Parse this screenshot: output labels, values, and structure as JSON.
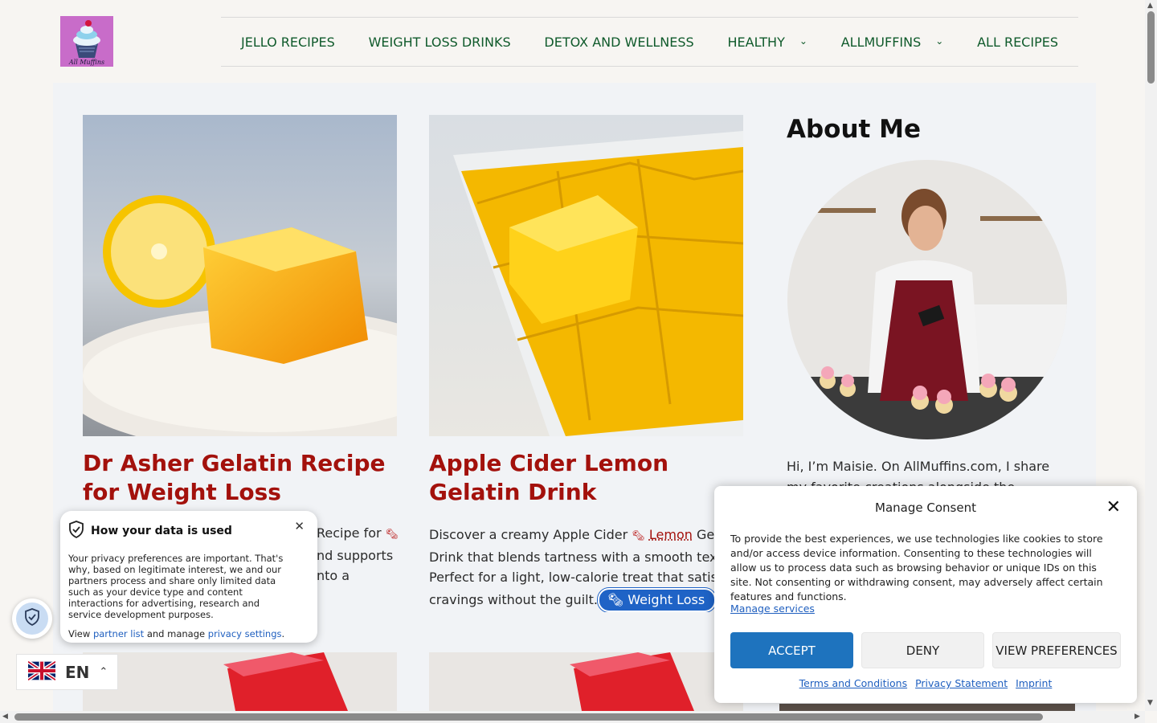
{
  "header": {
    "logo_text": "All Muffins",
    "nav": [
      {
        "label": "JELLO RECIPES",
        "has_dropdown": false
      },
      {
        "label": "WEIGHT LOSS DRINKS",
        "has_dropdown": false
      },
      {
        "label": "DETOX AND WELLNESS",
        "has_dropdown": false
      },
      {
        "label": "HEALTHY",
        "has_dropdown": true
      },
      {
        "label": "ALLMUFFINS",
        "has_dropdown": true
      },
      {
        "label": "ALL RECIPES",
        "has_dropdown": false
      }
    ]
  },
  "cards": [
    {
      "title": "Dr Asher Gelatin Recipe for Weight Loss",
      "excerpt_visible_1": "Recipe for",
      "excerpt_visible_2": "nd supports",
      "excerpt_visible_3": "nto a"
    },
    {
      "title": "Apple Cider Lemon Gelatin Drink",
      "excerpt_line1_a": "Discover a creamy Apple Cider",
      "excerpt_keyword": "Lemon",
      "excerpt_line1_b": "Gela",
      "excerpt_line2": "Drink that blends tartness with a smooth text",
      "excerpt_line3": "Perfect for a light, low-calorie treat that satisf",
      "excerpt_line4": "cravings without the guilt.",
      "tag": "Weight Loss"
    }
  ],
  "about": {
    "title": "About Me",
    "text_line1": "Hi, I’m Maisie. On AllMuffins.com, I share",
    "text_line2": "my favorite creations alongside the"
  },
  "privacy_popup": {
    "title": "How your data is used",
    "body": "Your privacy preferences are important. That's why, based on legitimate interest, we and our partners process and share only limited data such as your device type and content interactions for advertising, research and service development purposes.",
    "foot_prefix": "View",
    "partner_link": "partner list",
    "foot_middle": "and manage",
    "settings_link": "privacy settings",
    "foot_suffix": "."
  },
  "language": {
    "code": "EN"
  },
  "consent": {
    "title": "Manage Consent",
    "text": "To provide the best experiences, we use technologies like cookies to store and/or access device information. Consenting to these technologies will allow us to process data such as browsing behavior or unique IDs on this site. Not consenting or withdrawing consent, may adversely affect certain features and functions.",
    "manage_services": "Manage services",
    "accept": "ACCEPT",
    "deny": "DENY",
    "view_preferences": "VIEW PREFERENCES",
    "links": [
      "Terms and Conditions",
      "Privacy Statement",
      "Imprint"
    ]
  },
  "colors": {
    "nav_text": "#0f5a2b",
    "title_red": "#a3110c",
    "accept_blue": "#1e73be",
    "tag_blue": "#1f63c6"
  }
}
